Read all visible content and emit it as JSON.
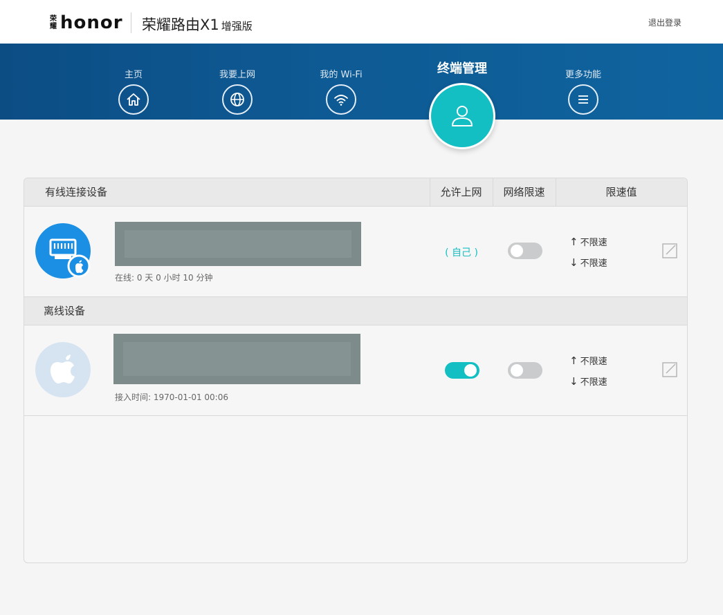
{
  "header": {
    "logo_cn": "荣耀",
    "logo_word": "honor",
    "product_name": "荣耀路由X1",
    "product_edition": "增强版",
    "logout_label": "退出登录"
  },
  "nav": {
    "items": [
      {
        "label": "主页",
        "icon": "home-icon"
      },
      {
        "label": "我要上网",
        "icon": "globe-icon"
      },
      {
        "label": "我的 Wi-Fi",
        "icon": "wifi-icon"
      },
      {
        "label": "终端管理",
        "icon": "user-icon",
        "active": true
      },
      {
        "label": "更多功能",
        "icon": "menu-icon"
      }
    ]
  },
  "table": {
    "columns": {
      "allow_internet": "允许上网",
      "speed_limit": "网络限速",
      "speed_value": "限速值"
    },
    "wired_section": {
      "title": "有线连接设备",
      "devices": [
        {
          "icon": "ethernet-apple-icon",
          "status_text": "在线: 0 天 0 小时 10 分钟",
          "allow_text": "( 自己 )",
          "speed_limit_on": false,
          "up_label": "不限速",
          "down_label": "不限速"
        }
      ]
    },
    "offline_section": {
      "title": "离线设备",
      "devices": [
        {
          "icon": "apple-icon",
          "status_text": "接入时间: 1970-01-01 00:06",
          "allow_internet_on": true,
          "speed_limit_on": false,
          "up_label": "不限速",
          "down_label": "不限速"
        }
      ]
    }
  },
  "colors": {
    "accent": "#14bfc3",
    "nav_bg": "#0e5a94",
    "brand_red": "#e60012",
    "wired_icon_bg": "#1a8fe3",
    "offline_icon_bg": "#d6e4f2"
  }
}
